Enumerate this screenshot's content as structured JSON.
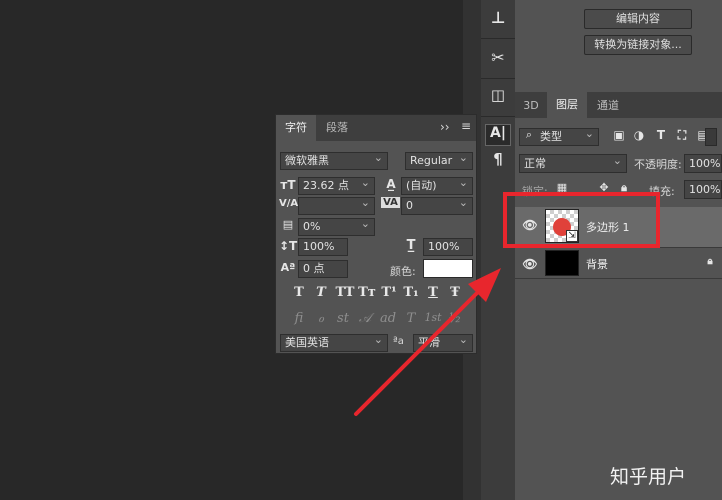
{
  "props": {
    "edit_contents": "编辑内容",
    "convert_linked": "转换为链接对象..."
  },
  "character": {
    "tabs": [
      "字符",
      "段落"
    ],
    "menu_icon": "≡",
    "collapse_icon": "››",
    "font_family": "微软雅黑",
    "font_style": "Regular",
    "font_size": "23.62 点",
    "leading": "(自动)",
    "kerning": "",
    "tracking": "0",
    "tsume": "0%",
    "vertical_scale": "100%",
    "horizontal_scale": "100%",
    "baseline_shift": "0 点",
    "color_label": "颜色:",
    "text_color": "#ffffff",
    "style_glyphs": [
      "T",
      "T",
      "TT",
      "Tт",
      "T¹",
      "T₁",
      "T",
      "Ŧ"
    ],
    "opentype_glyphs": [
      "fi",
      "ℴ",
      "st",
      "𝒜",
      "ad",
      "T",
      "1st",
      "½"
    ],
    "language": "美国英语",
    "aa_icon": "ªa",
    "anti_alias": "平滑"
  },
  "layers": {
    "tabs": [
      "3D",
      "图层",
      "通道"
    ],
    "active_tab": "图层",
    "filter_kind": "类型",
    "blend_mode": "正常",
    "opacity_label": "不透明度:",
    "opacity": "100%",
    "lock_label": "锁定:",
    "fill_label": "填充:",
    "fill": "100%",
    "items": [
      {
        "name": "多边形 1",
        "selected": true,
        "visible": true
      },
      {
        "name": "背景",
        "selected": false,
        "visible": true,
        "locked": true
      }
    ]
  },
  "annotation_color": "#e8262d",
  "watermark": "知乎用户"
}
